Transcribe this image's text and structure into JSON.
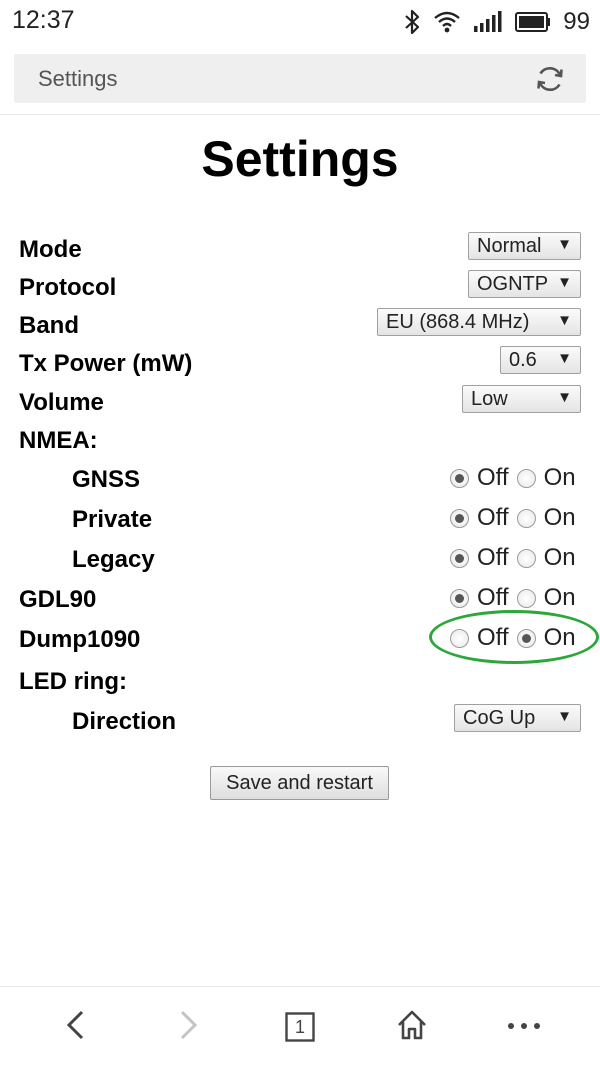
{
  "status_bar": {
    "time": "12:37",
    "battery": "99",
    "icons": [
      "bluetooth-icon",
      "wifi-icon",
      "signal-icon",
      "battery-icon"
    ]
  },
  "browser": {
    "address_text": "Settings",
    "tab_count": "1"
  },
  "page": {
    "title": "Settings",
    "rows": {
      "mode": {
        "label": "Mode",
        "value": "Normal"
      },
      "protocol": {
        "label": "Protocol",
        "value": "OGNTP"
      },
      "band": {
        "label": "Band",
        "value": "EU (868.4 MHz)"
      },
      "tx_power": {
        "label": "Tx Power (mW)",
        "value": "0.6"
      },
      "volume": {
        "label": "Volume",
        "value": "Low"
      },
      "nmea": {
        "label": "NMEA:"
      },
      "gnss": {
        "label": "GNSS",
        "selected": "Off"
      },
      "private": {
        "label": "Private",
        "selected": "Off"
      },
      "legacy": {
        "label": "Legacy",
        "selected": "Off"
      },
      "gdl90": {
        "label": "GDL90",
        "selected": "Off"
      },
      "dump1090": {
        "label": "Dump1090",
        "selected": "On"
      },
      "led_ring": {
        "label": "LED ring:"
      },
      "direction": {
        "label": "Direction",
        "value": "CoG Up"
      }
    },
    "radio_options": {
      "off": "Off",
      "on": "On"
    },
    "save_button": "Save and restart"
  },
  "colors": {
    "highlight": "#2da63a",
    "address_bar_bg": "#efefef"
  }
}
